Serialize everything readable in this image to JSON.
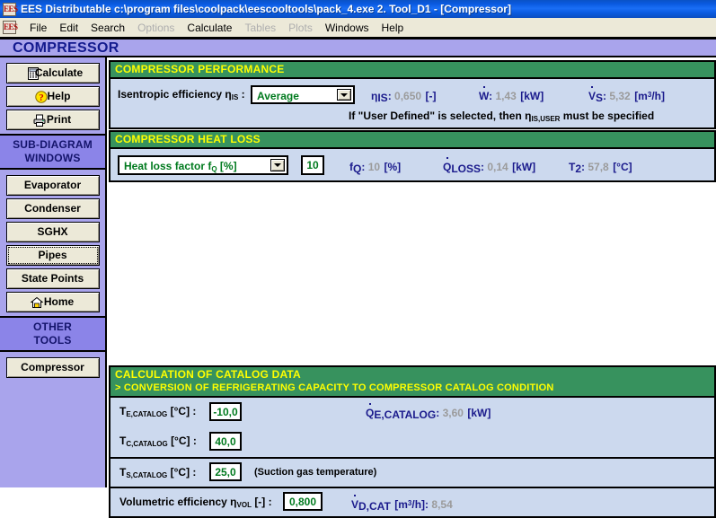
{
  "window": {
    "title": "EES Distributable  c:\\program files\\coolpack\\eescooltools\\pack_4.exe   2. Tool_D1 - [Compressor]",
    "app_icon": "ees-icon"
  },
  "menubar": {
    "icon": "ees-icon",
    "items": [
      {
        "label": "File",
        "enabled": true
      },
      {
        "label": "Edit",
        "enabled": true
      },
      {
        "label": "Search",
        "enabled": true
      },
      {
        "label": "Options",
        "enabled": false
      },
      {
        "label": "Calculate",
        "enabled": true
      },
      {
        "label": "Tables",
        "enabled": false
      },
      {
        "label": "Plots",
        "enabled": false
      },
      {
        "label": "Windows",
        "enabled": true
      },
      {
        "label": "Help",
        "enabled": true
      }
    ]
  },
  "banner": {
    "title": "COMPRESSOR"
  },
  "sidebar": {
    "actions": [
      {
        "label": "Calculate",
        "icon": "calculator-icon"
      },
      {
        "label": "Help",
        "icon": "help-question-icon"
      },
      {
        "label": "Print",
        "icon": "printer-icon"
      }
    ],
    "section1": {
      "line1": "SUB-DIAGRAM",
      "line2": "WINDOWS"
    },
    "subdiagram": [
      {
        "label": "Evaporator",
        "selected": false
      },
      {
        "label": "Condenser",
        "selected": false
      },
      {
        "label": "SGHX",
        "selected": false
      },
      {
        "label": "Pipes",
        "selected": true
      },
      {
        "label": "State Points",
        "selected": false
      },
      {
        "label": "Home",
        "selected": false,
        "icon": "home-icon"
      }
    ],
    "section2": {
      "line1": "OTHER",
      "line2": "TOOLS"
    },
    "other_tools": [
      {
        "label": "Compressor",
        "selected": false
      }
    ]
  },
  "performance": {
    "header": "COMPRESSOR PERFORMANCE",
    "input_label_pre": "Isentropic efficiency",
    "input_symbol": "η",
    "input_symbol_sub": "IS",
    "combo_value": "Average",
    "combo_options": [
      "Average",
      "User Defined"
    ],
    "results": [
      {
        "symbol": "η",
        "sub": "IS",
        "sup": "",
        "dot": false,
        "value": "0,650",
        "unit": "[-]"
      },
      {
        "symbol": "W",
        "sub": "",
        "sup": "",
        "dot": true,
        "value": "1,43",
        "unit": "[kW]"
      },
      {
        "symbol": "V",
        "sub": "S",
        "sup": "",
        "dot": true,
        "value": "5,32",
        "unit": "[m³/h]"
      }
    ],
    "note_pre": "If \"User Defined\" is selected, then ",
    "note_symbol": "η",
    "note_sub": "IS,USER",
    "note_post": " must be specified"
  },
  "heatloss": {
    "header": "COMPRESSOR HEAT LOSS",
    "combo_value": "Heat loss factor f",
    "combo_value_sub": "Q",
    "combo_value_post": " [%]",
    "combo_options": [
      "Heat loss factor fQ [%]"
    ],
    "input_value": "10",
    "results": [
      {
        "symbol": "f",
        "sub": "Q",
        "dot": false,
        "value": "10",
        "unit": "[%]"
      },
      {
        "symbol": "Q",
        "sub": "LOSS",
        "dot": true,
        "value": "0,14",
        "unit": "[kW]"
      },
      {
        "symbol": "T",
        "sub": "2",
        "dot": false,
        "value": "57,8",
        "unit": "[°C]"
      }
    ]
  },
  "catalog": {
    "header_line1": "CALCULATION OF CATALOG DATA",
    "header_line2": "> CONVERSION OF REFRIGERATING CAPACITY TO COMPRESSOR CATALOG CONDITION",
    "rows": [
      {
        "symbol": "T",
        "sub": "E,CATALOG",
        "unit": "[°C]",
        "value": "-10,0"
      },
      {
        "symbol": "T",
        "sub": "C,CATALOG",
        "unit": "[°C]",
        "value": "40,0"
      },
      {
        "symbol": "T",
        "sub": "S,CATALOG",
        "unit": "[°C]",
        "value": "25,0",
        "note": "(Suction gas temperature)"
      }
    ],
    "result_qe": {
      "symbol": "Q",
      "sub": "E,CATALOG",
      "dot": true,
      "value": "3,60",
      "unit": "[kW]"
    },
    "vol_eff": {
      "label_pre": "Volumetric efficiency",
      "symbol": "η",
      "sub": "VOL",
      "unit": "[-]",
      "value": "0,800"
    },
    "result_vd": {
      "symbol": "V",
      "sub": "D,CAT",
      "dot": true,
      "unit": "[m³/h]",
      "value": "8,54"
    }
  },
  "colors": {
    "titlebar_blue": "#0a5ae0",
    "banner_purple": "#a9a4ec",
    "section_purple": "#8b84e8",
    "green_header": "#37925e",
    "header_text_yellow": "#ffff00",
    "panel_blue": "#ccd9ee",
    "input_green": "#007a1e",
    "label_navy": "#1a1a8c",
    "value_gray": "#9b9b9b",
    "button_face": "#ece9d8"
  }
}
